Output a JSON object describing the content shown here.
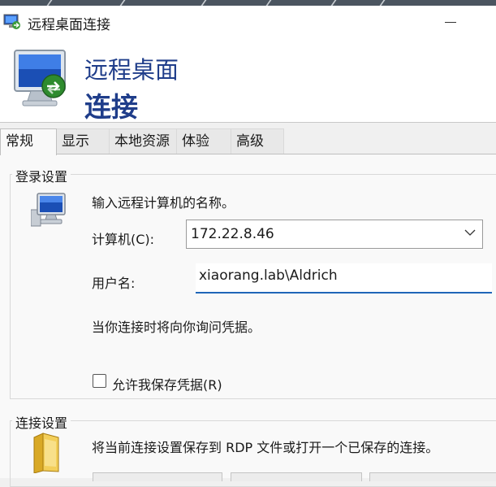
{
  "window": {
    "title": "远程桌面连接"
  },
  "banner": {
    "line1": "远程桌面",
    "line2": "连接"
  },
  "tabs": [
    {
      "label": "常规",
      "active": true
    },
    {
      "label": "显示",
      "active": false
    },
    {
      "label": "本地资源",
      "active": false
    },
    {
      "label": "体验",
      "active": false
    },
    {
      "label": "高级",
      "active": false
    }
  ],
  "login": {
    "legend": "登录设置",
    "prompt": "输入远程计算机的名称。",
    "computer_label": "计算机(C):",
    "computer_value": "172.22.8.46",
    "username_label": "用户名:",
    "username_value": "xiaorang.lab\\Aldrich",
    "info": "当你连接时将向你询问凭据。",
    "save_credentials_label": "允许我保存凭据(R)",
    "save_credentials_checked": false
  },
  "connection": {
    "legend": "连接设置",
    "description": "将当前连接设置保存到 RDP 文件或打开一个已保存的连接。"
  },
  "colors": {
    "banner_text": "#1f3d8a",
    "focus_underline": "#1f66b8",
    "window_bg": "#f0f0f0"
  },
  "icons": [
    "rdp-app-icon",
    "minimize-icon",
    "rdp-banner-monitor-icon",
    "computer-icon",
    "chevron-down-icon",
    "folder-icon"
  ]
}
